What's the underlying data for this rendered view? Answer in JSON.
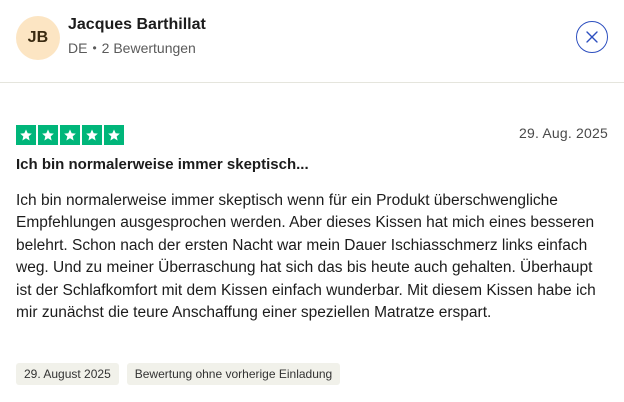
{
  "user": {
    "initials": "JB",
    "name": "Jacques Barthillat",
    "country": "DE",
    "reviews_count": "2 Bewertungen"
  },
  "review": {
    "rating": 5,
    "date": "29. Aug. 2025",
    "title": "Ich bin normalerweise immer skeptisch...",
    "text": "Ich bin normalerweise immer skeptisch wenn für ein Produkt überschwengliche Empfehlungen ausgesprochen werden. Aber dieses Kissen hat mich eines besseren belehrt. Schon nach der ersten Nacht war mein Dauer Ischiasschmerz links einfach weg. Und zu meiner Überraschung hat sich das bis heute auch gehalten. Überhaupt ist der Schlafkomfort mit dem Kissen einfach wunderbar. Mit diesem Kissen habe ich mir zunächst die teure Anschaffung einer speziellen Matratze erspart.",
    "tags": {
      "experience_date": "29. August 2025",
      "invitation": "Bewertung ohne vorherige Einladung"
    }
  },
  "icons": {
    "close": "close-icon",
    "star": "star-icon"
  },
  "colors": {
    "star_green": "#00b67a",
    "avatar_bg": "#fce5c3",
    "close_blue": "#2d4fbf"
  }
}
